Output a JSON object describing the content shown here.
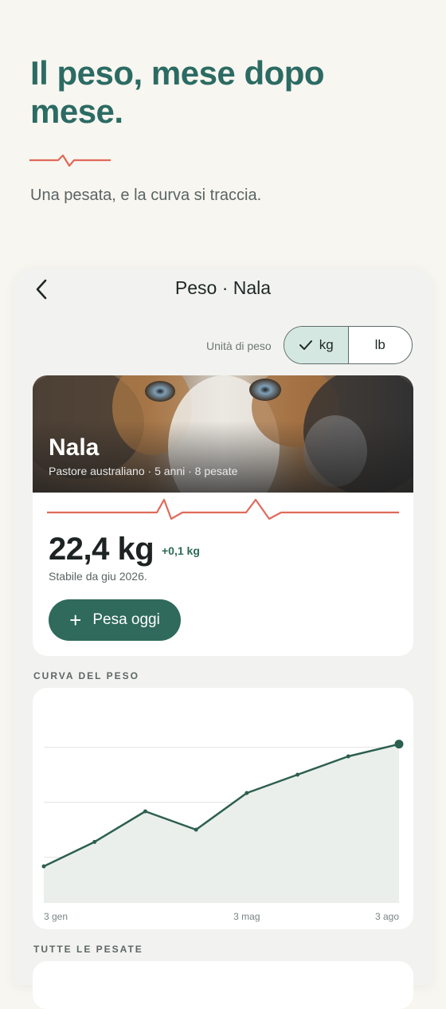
{
  "hero": {
    "title": "Il peso, mese dopo mese.",
    "subtitle": "Una pesata, e la curva si traccia."
  },
  "screen": {
    "title": "Peso · Nala",
    "back_icon": "chevron-left-icon"
  },
  "unit": {
    "label": "Unità di peso",
    "options": [
      "kg",
      "lb"
    ],
    "selected": "kg"
  },
  "pet": {
    "name": "Nala",
    "meta": "Pastore australiano · 5 anni · 8 pesate",
    "weight": "22,4 kg",
    "delta": "+0,1 kg",
    "status": "Stabile da giu 2026.",
    "weigh_button": "Pesa oggi"
  },
  "sections": {
    "curve": "CURVA DEL PESO",
    "all": "TUTTE LE PESATE"
  },
  "colors": {
    "accent": "#2b6b63",
    "button": "#2f6a5c",
    "pulse": "#e06a5a",
    "line": "#2d5f50"
  },
  "chart_data": {
    "type": "area",
    "title": "CURVA DEL PESO",
    "x": [
      "3 gen",
      "",
      "",
      "",
      "3 mag",
      "",
      "",
      "3 ago"
    ],
    "tick_labels": [
      "3 gen",
      "3 mag",
      "3 ago"
    ],
    "series": [
      {
        "values": [
          21.4,
          21.6,
          21.85,
          21.7,
          22.0,
          22.15,
          22.3,
          22.4
        ]
      }
    ],
    "ylim": [
      21.1,
      22.6
    ],
    "grid": true,
    "y_tick_labels_shown": false
  }
}
